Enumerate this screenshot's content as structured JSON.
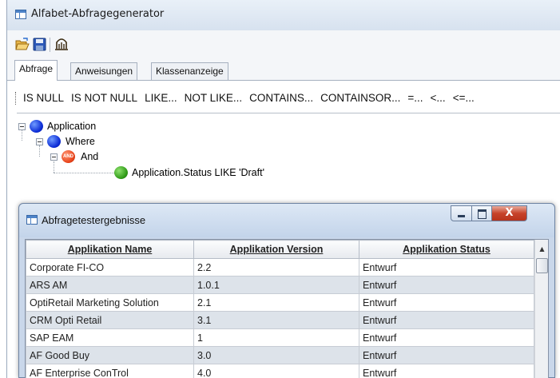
{
  "app": {
    "title": "Alfabet-Abfragegenerator"
  },
  "toolbar": {
    "open_icon": "folder-open-icon",
    "save_icon": "floppy-disk-icon",
    "query_icon": "query-icon"
  },
  "tabs": [
    {
      "label": "Abfrage",
      "active": true
    },
    {
      "label": "Anweisungen",
      "active": false
    },
    {
      "label": "Klassenanzeige",
      "active": false
    }
  ],
  "operators": [
    "IS NULL",
    "IS NOT NULL",
    "LIKE...",
    "NOT LIKE...",
    "CONTAINS...",
    "CONTAINSOR...",
    "=...",
    "<...",
    "<=..."
  ],
  "tree": {
    "root": "Application",
    "where": "Where",
    "and": "And",
    "and_badge": "AND",
    "condition": "Application.Status LIKE 'Draft'"
  },
  "results": {
    "title": "Abfragetestergebnisse",
    "close_glyph": "X",
    "columns": [
      "Applikation Name",
      "Applikation Version",
      "Applikation Status"
    ],
    "rows": [
      [
        "Corporate FI-CO",
        "2.2",
        "Entwurf"
      ],
      [
        "ARS AM",
        "1.0.1",
        "Entwurf"
      ],
      [
        "OptiRetail Marketing Solution",
        "2.1",
        "Entwurf"
      ],
      [
        "CRM Opti Retail",
        "3.1",
        "Entwurf"
      ],
      [
        "SAP EAM",
        "1",
        "Entwurf"
      ],
      [
        "AF Good Buy",
        "3.0",
        "Entwurf"
      ],
      [
        "AF Enterprise ConTrol",
        "4.0",
        "Entwurf"
      ]
    ]
  }
}
